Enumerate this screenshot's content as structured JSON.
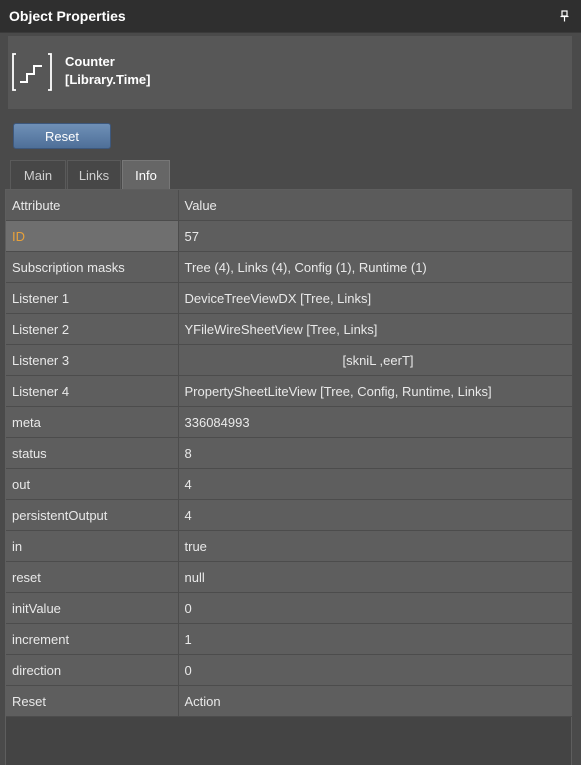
{
  "panel": {
    "title": "Object Properties",
    "pin_icon": "pin-icon"
  },
  "object": {
    "icon": "counter-icon",
    "name": "Counter",
    "type": "[Library.Time]"
  },
  "actions": {
    "reset_label": "Reset"
  },
  "tabs": [
    {
      "label": "Main",
      "active": false
    },
    {
      "label": "Links",
      "active": false
    },
    {
      "label": "Info",
      "active": true
    }
  ],
  "table": {
    "headers": {
      "attribute": "Attribute",
      "value": "Value"
    },
    "rows": [
      {
        "attribute": "ID",
        "value": "57"
      },
      {
        "attribute": "Subscription masks",
        "value": "Tree (4), Links (4), Config (1), Runtime (1)"
      },
      {
        "attribute": "Listener 1",
        "value": "DeviceTreeViewDX [Tree, Links]"
      },
      {
        "attribute": "Listener 2",
        "value": "YFileWireSheetView [Tree, Links]"
      },
      {
        "attribute": "Listener 3",
        "value": "[skniL ,eerT]"
      },
      {
        "attribute": "Listener 4",
        "value": "PropertySheetLiteView [Tree, Config, Runtime, Links]"
      },
      {
        "attribute": "meta",
        "value": "336084993"
      },
      {
        "attribute": "status",
        "value": "8"
      },
      {
        "attribute": "out",
        "value": "4"
      },
      {
        "attribute": "persistentOutput",
        "value": "4"
      },
      {
        "attribute": "in",
        "value": "true"
      },
      {
        "attribute": "reset",
        "value": "null"
      },
      {
        "attribute": "initValue",
        "value": "0"
      },
      {
        "attribute": "increment",
        "value": "1"
      },
      {
        "attribute": "direction",
        "value": "0"
      },
      {
        "attribute": "Reset",
        "value": "Action"
      }
    ]
  },
  "colors": {
    "accent_selected": "#e8a13a",
    "button": "#5d7fa8"
  }
}
